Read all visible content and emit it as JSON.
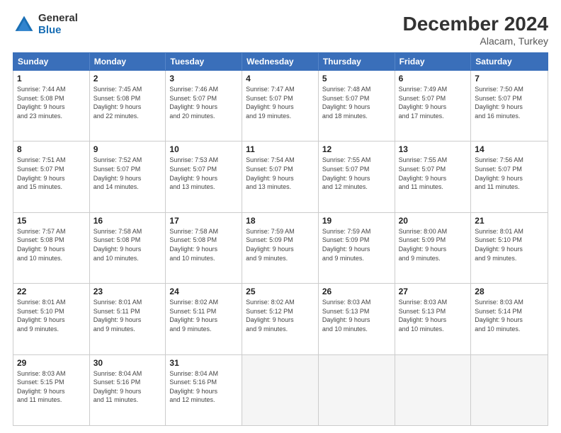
{
  "logo": {
    "general": "General",
    "blue": "Blue"
  },
  "title": "December 2024",
  "location": "Alacam, Turkey",
  "header_days": [
    "Sunday",
    "Monday",
    "Tuesday",
    "Wednesday",
    "Thursday",
    "Friday",
    "Saturday"
  ],
  "weeks": [
    [
      {
        "day": "1",
        "info": "Sunrise: 7:44 AM\nSunset: 5:08 PM\nDaylight: 9 hours\nand 23 minutes."
      },
      {
        "day": "2",
        "info": "Sunrise: 7:45 AM\nSunset: 5:08 PM\nDaylight: 9 hours\nand 22 minutes."
      },
      {
        "day": "3",
        "info": "Sunrise: 7:46 AM\nSunset: 5:07 PM\nDaylight: 9 hours\nand 20 minutes."
      },
      {
        "day": "4",
        "info": "Sunrise: 7:47 AM\nSunset: 5:07 PM\nDaylight: 9 hours\nand 19 minutes."
      },
      {
        "day": "5",
        "info": "Sunrise: 7:48 AM\nSunset: 5:07 PM\nDaylight: 9 hours\nand 18 minutes."
      },
      {
        "day": "6",
        "info": "Sunrise: 7:49 AM\nSunset: 5:07 PM\nDaylight: 9 hours\nand 17 minutes."
      },
      {
        "day": "7",
        "info": "Sunrise: 7:50 AM\nSunset: 5:07 PM\nDaylight: 9 hours\nand 16 minutes."
      }
    ],
    [
      {
        "day": "8",
        "info": "Sunrise: 7:51 AM\nSunset: 5:07 PM\nDaylight: 9 hours\nand 15 minutes."
      },
      {
        "day": "9",
        "info": "Sunrise: 7:52 AM\nSunset: 5:07 PM\nDaylight: 9 hours\nand 14 minutes."
      },
      {
        "day": "10",
        "info": "Sunrise: 7:53 AM\nSunset: 5:07 PM\nDaylight: 9 hours\nand 13 minutes."
      },
      {
        "day": "11",
        "info": "Sunrise: 7:54 AM\nSunset: 5:07 PM\nDaylight: 9 hours\nand 13 minutes."
      },
      {
        "day": "12",
        "info": "Sunrise: 7:55 AM\nSunset: 5:07 PM\nDaylight: 9 hours\nand 12 minutes."
      },
      {
        "day": "13",
        "info": "Sunrise: 7:55 AM\nSunset: 5:07 PM\nDaylight: 9 hours\nand 11 minutes."
      },
      {
        "day": "14",
        "info": "Sunrise: 7:56 AM\nSunset: 5:07 PM\nDaylight: 9 hours\nand 11 minutes."
      }
    ],
    [
      {
        "day": "15",
        "info": "Sunrise: 7:57 AM\nSunset: 5:08 PM\nDaylight: 9 hours\nand 10 minutes."
      },
      {
        "day": "16",
        "info": "Sunrise: 7:58 AM\nSunset: 5:08 PM\nDaylight: 9 hours\nand 10 minutes."
      },
      {
        "day": "17",
        "info": "Sunrise: 7:58 AM\nSunset: 5:08 PM\nDaylight: 9 hours\nand 10 minutes."
      },
      {
        "day": "18",
        "info": "Sunrise: 7:59 AM\nSunset: 5:09 PM\nDaylight: 9 hours\nand 9 minutes."
      },
      {
        "day": "19",
        "info": "Sunrise: 7:59 AM\nSunset: 5:09 PM\nDaylight: 9 hours\nand 9 minutes."
      },
      {
        "day": "20",
        "info": "Sunrise: 8:00 AM\nSunset: 5:09 PM\nDaylight: 9 hours\nand 9 minutes."
      },
      {
        "day": "21",
        "info": "Sunrise: 8:01 AM\nSunset: 5:10 PM\nDaylight: 9 hours\nand 9 minutes."
      }
    ],
    [
      {
        "day": "22",
        "info": "Sunrise: 8:01 AM\nSunset: 5:10 PM\nDaylight: 9 hours\nand 9 minutes."
      },
      {
        "day": "23",
        "info": "Sunrise: 8:01 AM\nSunset: 5:11 PM\nDaylight: 9 hours\nand 9 minutes."
      },
      {
        "day": "24",
        "info": "Sunrise: 8:02 AM\nSunset: 5:11 PM\nDaylight: 9 hours\nand 9 minutes."
      },
      {
        "day": "25",
        "info": "Sunrise: 8:02 AM\nSunset: 5:12 PM\nDaylight: 9 hours\nand 9 minutes."
      },
      {
        "day": "26",
        "info": "Sunrise: 8:03 AM\nSunset: 5:13 PM\nDaylight: 9 hours\nand 10 minutes."
      },
      {
        "day": "27",
        "info": "Sunrise: 8:03 AM\nSunset: 5:13 PM\nDaylight: 9 hours\nand 10 minutes."
      },
      {
        "day": "28",
        "info": "Sunrise: 8:03 AM\nSunset: 5:14 PM\nDaylight: 9 hours\nand 10 minutes."
      }
    ],
    [
      {
        "day": "29",
        "info": "Sunrise: 8:03 AM\nSunset: 5:15 PM\nDaylight: 9 hours\nand 11 minutes."
      },
      {
        "day": "30",
        "info": "Sunrise: 8:04 AM\nSunset: 5:16 PM\nDaylight: 9 hours\nand 11 minutes."
      },
      {
        "day": "31",
        "info": "Sunrise: 8:04 AM\nSunset: 5:16 PM\nDaylight: 9 hours\nand 12 minutes."
      },
      {
        "day": "",
        "info": ""
      },
      {
        "day": "",
        "info": ""
      },
      {
        "day": "",
        "info": ""
      },
      {
        "day": "",
        "info": ""
      }
    ]
  ]
}
